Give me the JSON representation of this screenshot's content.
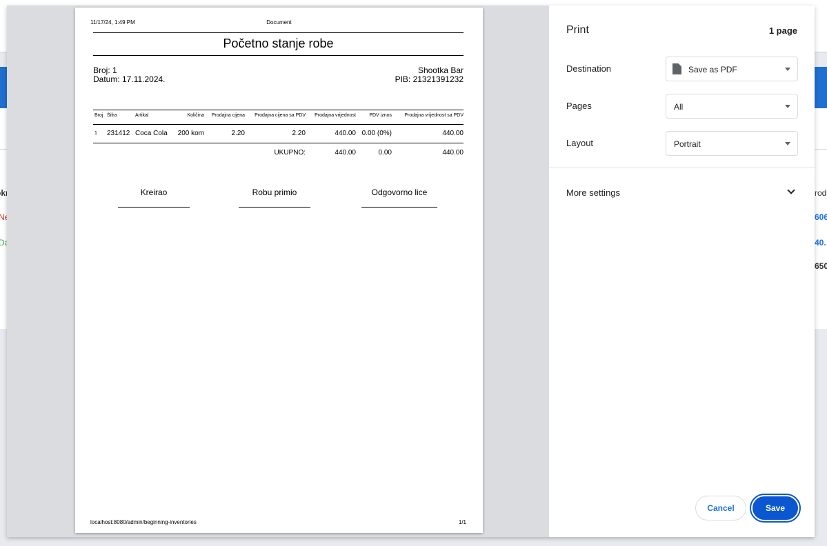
{
  "background": {
    "left_fragments": [
      "okr",
      "Ne",
      "Da"
    ],
    "right_fragments": [
      "roda",
      "606",
      "40.",
      "650"
    ]
  },
  "preview": {
    "header": {
      "datetime": "11/17/24, 1:49 PM",
      "title": "Document"
    },
    "doc_title": "Početno stanje robe",
    "info_left": {
      "broj": "Broj: 1",
      "datum": "Datum: 17.11.2024."
    },
    "info_right": {
      "company": "Shootka Bar",
      "pib": "PIB: 21321391232"
    },
    "table": {
      "headers": [
        "Broj",
        "Šifra",
        "Artikal",
        "Količina",
        "Prodajna cijena",
        "Prodajna cijena sa PDV",
        "Prodajna vrijednost",
        "PDV iznos",
        "Prodajna vrijednost sa PDV"
      ],
      "rows": [
        [
          "1",
          "231412",
          "Coca Cola",
          "200 kom",
          "2.20",
          "2.20",
          "440.00",
          "0.00 (0%)",
          "440.00"
        ]
      ],
      "totals": {
        "label": "UKUPNO:",
        "prodajna_vrijednost": "440.00",
        "pdv_iznos": "0.00",
        "prodajna_vrijednost_sa_pdv": "440.00"
      }
    },
    "signatures": [
      "Kreirao",
      "Robu primio",
      "Odgovorno lice"
    ],
    "footer": {
      "url": "localhost:8080/admin/beginning-inventories",
      "page": "1/1"
    }
  },
  "panel": {
    "title": "Print",
    "page_count": "1 page",
    "destination": {
      "label": "Destination",
      "value": "Save as PDF",
      "icon": "document-icon"
    },
    "pages": {
      "label": "Pages",
      "value": "All"
    },
    "layout": {
      "label": "Layout",
      "value": "Portrait"
    },
    "more_settings": "More settings",
    "cancel_label": "Cancel",
    "save_label": "Save"
  },
  "colors": {
    "accent": "#0b57d0",
    "link": "#1a73e8",
    "bg_bar": "#1f6fd0"
  }
}
